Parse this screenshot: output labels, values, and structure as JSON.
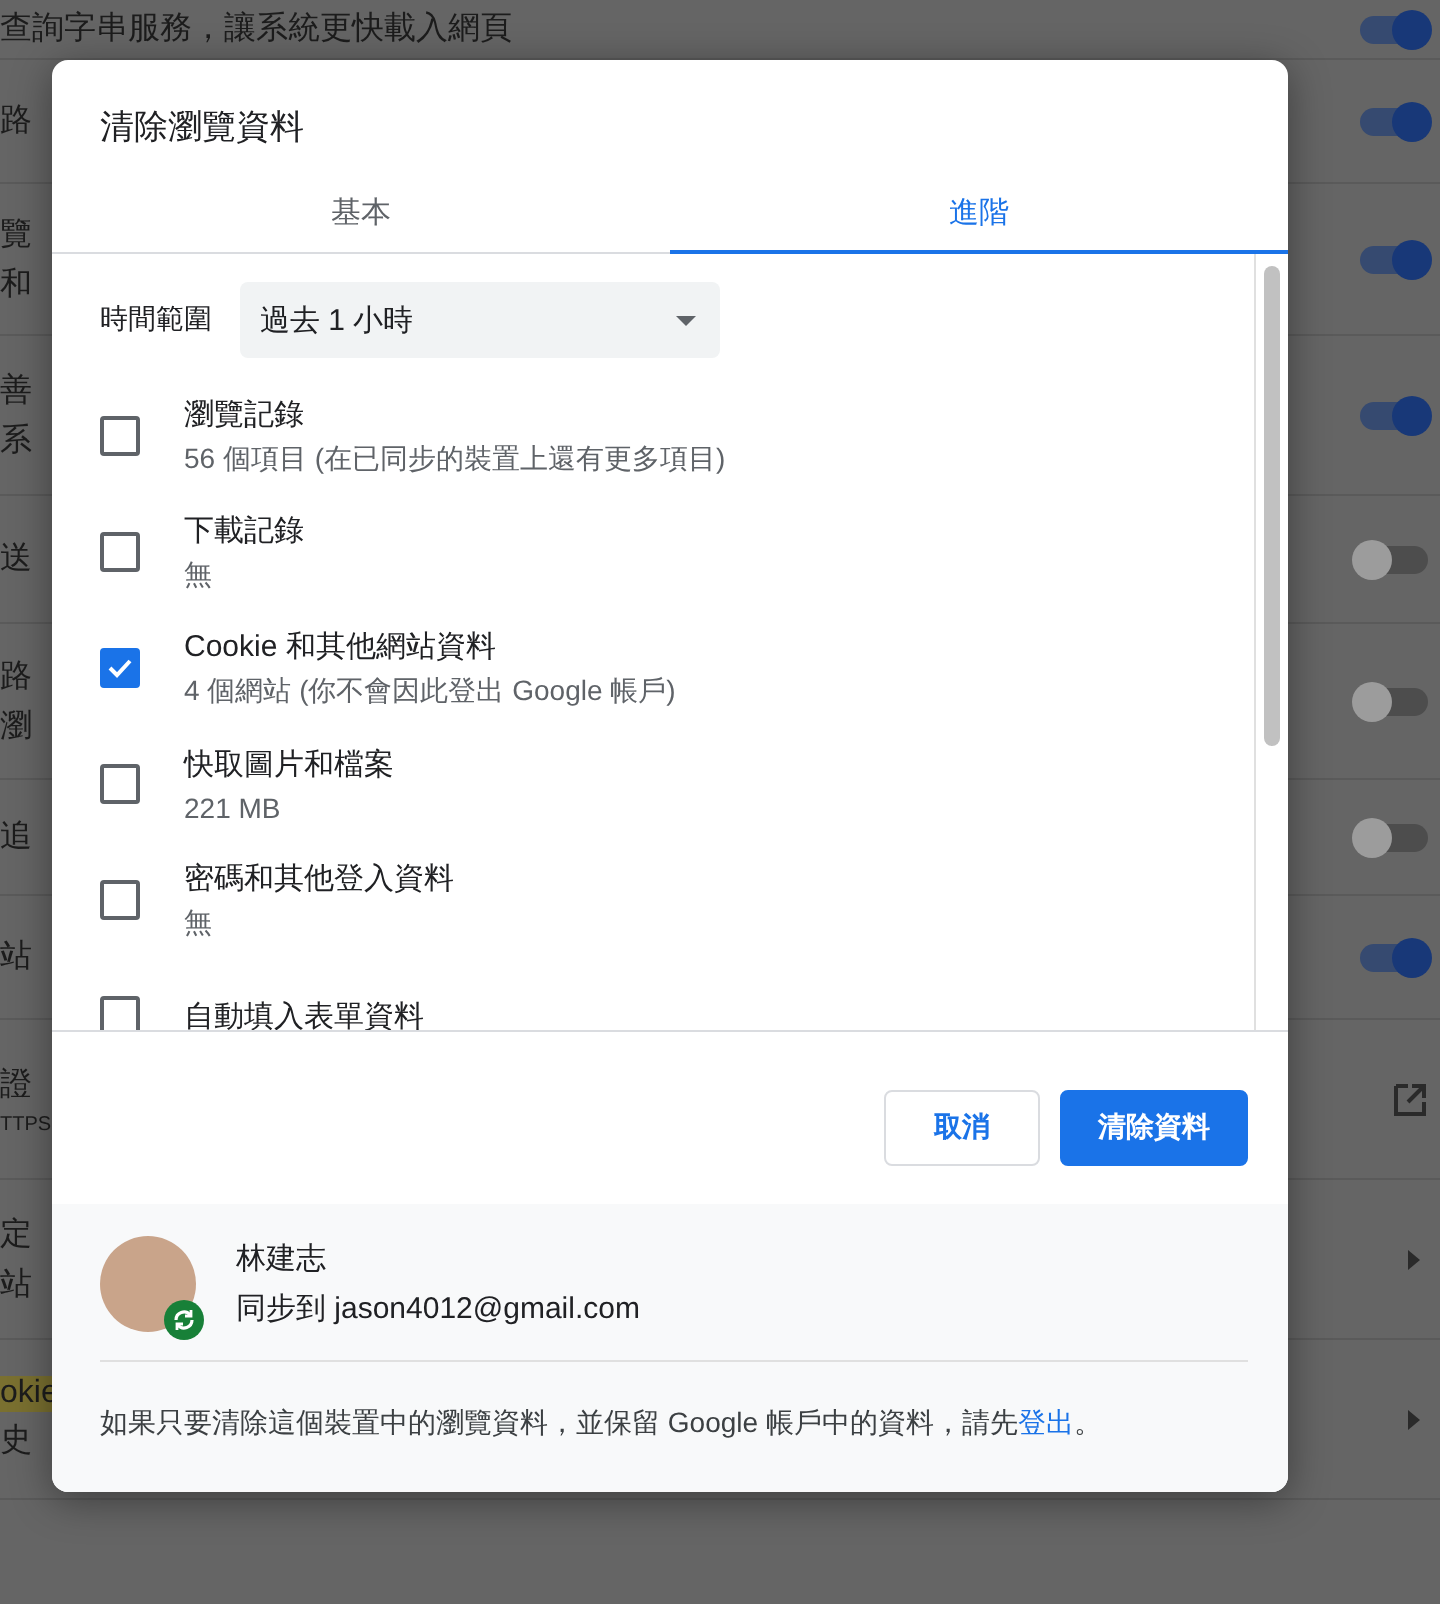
{
  "background": {
    "rows": [
      {
        "lines": [
          "查詢字串服務，讓系統更快載入網頁"
        ],
        "kind": "toggle",
        "on": true
      },
      {
        "lines": [
          "路"
        ],
        "kind": "toggle",
        "on": true
      },
      {
        "lines": [
          "覽",
          "和"
        ],
        "kind": "toggle",
        "on": true
      },
      {
        "lines": [
          "善",
          "系"
        ],
        "kind": "toggle",
        "on": true
      },
      {
        "lines": [
          "送"
        ],
        "kind": "toggle",
        "on": false
      },
      {
        "lines": [
          "路",
          "瀏"
        ],
        "kind": "toggle",
        "on": false
      },
      {
        "lines": [
          "追"
        ],
        "kind": "toggle",
        "on": false
      },
      {
        "lines": [
          "站"
        ],
        "kind": "toggle",
        "on": true
      },
      {
        "lines": [
          "證",
          "TTPS"
        ],
        "kind": "external"
      },
      {
        "lines": [
          "定",
          "站"
        ],
        "kind": "arrow"
      },
      {
        "lines": [
          "okie",
          "史"
        ],
        "kind": "arrow",
        "highlighted": true
      }
    ]
  },
  "dialog": {
    "title": "清除瀏覽資料",
    "tabs": [
      {
        "label": "基本",
        "selected": false
      },
      {
        "label": "進階",
        "selected": true
      }
    ],
    "time_range": {
      "label": "時間範圍",
      "value": "過去 1 小時"
    },
    "items": [
      {
        "label": "瀏覽記錄",
        "detail": "56 個項目 (在已同步的裝置上還有更多項目)",
        "checked": false
      },
      {
        "label": "下載記錄",
        "detail": "無",
        "checked": false
      },
      {
        "label": "Cookie 和其他網站資料",
        "detail": "4 個網站 (你不會因此登出 Google 帳戶)",
        "checked": true
      },
      {
        "label": "快取圖片和檔案",
        "detail": "221 MB",
        "checked": false
      },
      {
        "label": "密碼和其他登入資料",
        "detail": "無",
        "checked": false
      },
      {
        "label": "自動填入表單資料",
        "checked": false
      }
    ],
    "buttons": {
      "cancel": "取消",
      "confirm": "清除資料"
    },
    "account": {
      "name": "林建志",
      "sync": "同步到 jason4012@gmail.com"
    },
    "note": {
      "text": "如果只要清除這個裝置中的瀏覽資料，並保留 Google 帳戶中的資料，請先",
      "link": "登出",
      "end": "。"
    }
  }
}
